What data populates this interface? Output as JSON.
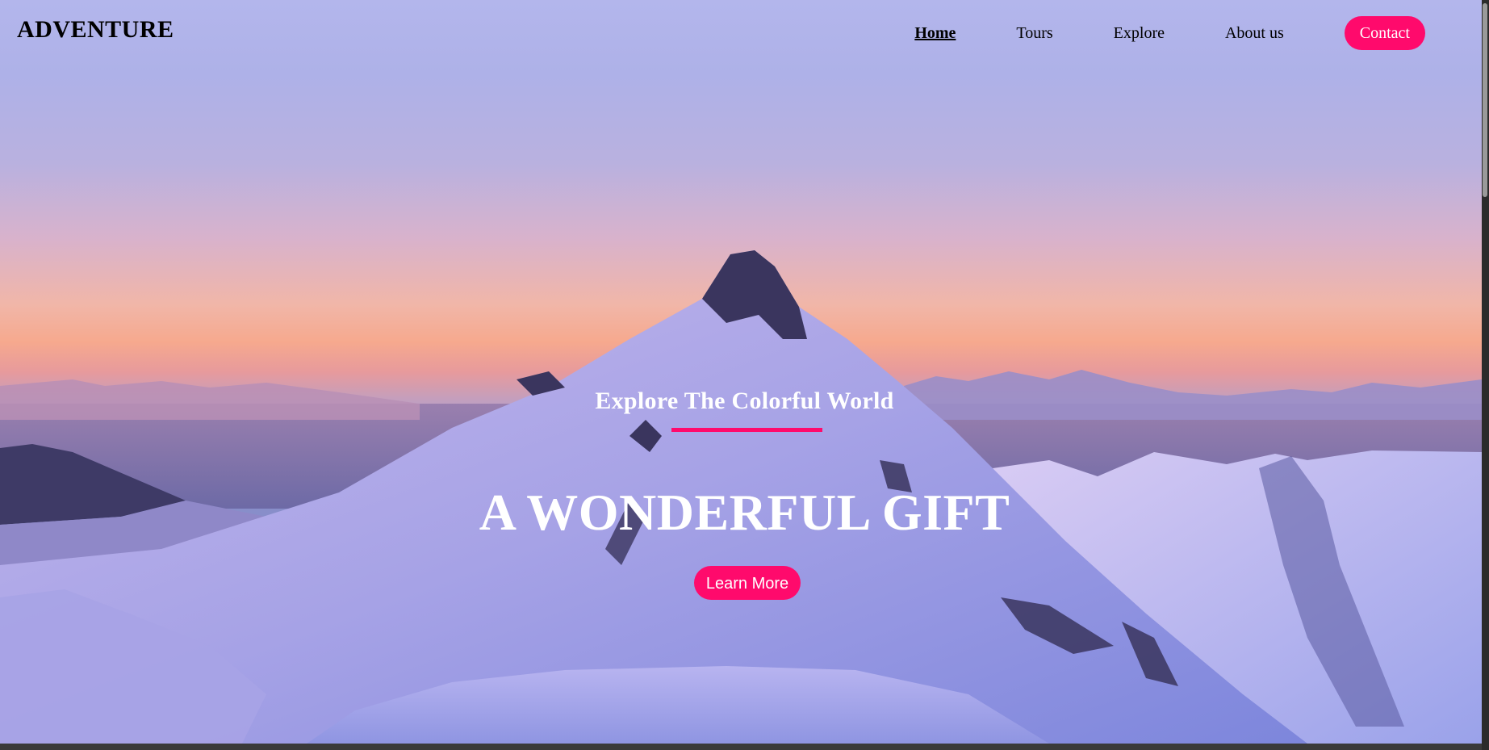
{
  "header": {
    "logo": "ADVENTURE",
    "nav": [
      {
        "label": "Home",
        "active": true
      },
      {
        "label": "Tours",
        "active": false
      },
      {
        "label": "Explore",
        "active": false
      },
      {
        "label": "About us",
        "active": false
      }
    ],
    "contact_label": "Contact"
  },
  "hero": {
    "tagline": "Explore The Colorful World",
    "headline": "A WONDERFUL GIFT",
    "cta_label": "Learn More",
    "image_description": "snowy-mountain-peak-at-sunset"
  },
  "colors": {
    "accent": "#ff0a6c",
    "text_dark": "#000000",
    "text_light": "#ffffff"
  }
}
